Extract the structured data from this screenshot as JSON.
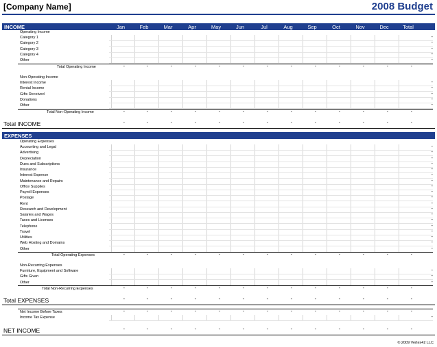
{
  "header": {
    "company": "[Company Name]",
    "title": "2008 Budget"
  },
  "months": [
    "Jan",
    "Feb",
    "Mar",
    "Apr",
    "May",
    "Jun",
    "Jul",
    "Aug",
    "Sep",
    "Oct",
    "Nov",
    "Dec",
    "Total"
  ],
  "income": {
    "band_label": "INCOME",
    "operating_heading": "Operating Income",
    "operating_items": [
      "Category 1",
      "Category 2",
      "Category 3",
      "Category 4",
      "Other"
    ],
    "operating_total": "Total Operating Income",
    "non_operating_heading": "Non-Operating Income",
    "non_operating_items": [
      "Interest Income",
      "Rental Income",
      "Gifts Received",
      "Donations",
      "Other"
    ],
    "non_operating_total": "Total Non-Operating Income",
    "total_label": "Total INCOME"
  },
  "expenses": {
    "band_label": "EXPENSES",
    "operating_heading": "Operating Expenses",
    "operating_items": [
      "Accounting and Legal",
      "Advertising",
      "Depreciation",
      "Dues and Subscriptions",
      "Insurance",
      "Interest Expense",
      "Maintenance and Repairs",
      "Office Supplies",
      "Payroll Expenses",
      "Postage",
      "Rent",
      "Research and Development",
      "Salaries and Wages",
      "Taxes and Licenses",
      "Telephone",
      "Travel",
      "Utilities",
      "Web Hosting and Domains",
      "Other"
    ],
    "operating_total": "Total Operating Expenses",
    "non_recurring_heading": "Non-Recurring Expenses",
    "non_recurring_items": [
      "Furniture, Equipment and Software",
      "Gifts Given",
      "Other"
    ],
    "non_recurring_total": "Total Non-Recurring Expenses",
    "total_label": "Total EXPENSES"
  },
  "net": {
    "before_taxes": "Net Income Before Taxes",
    "tax_expense": "Income Tax Expense",
    "net_income": "NET INCOME"
  },
  "empty_value": "-",
  "copyright": "© 2009 Vertex42 LLC",
  "colors": {
    "band": "#1f3f8f",
    "title": "#1f3f8f"
  }
}
